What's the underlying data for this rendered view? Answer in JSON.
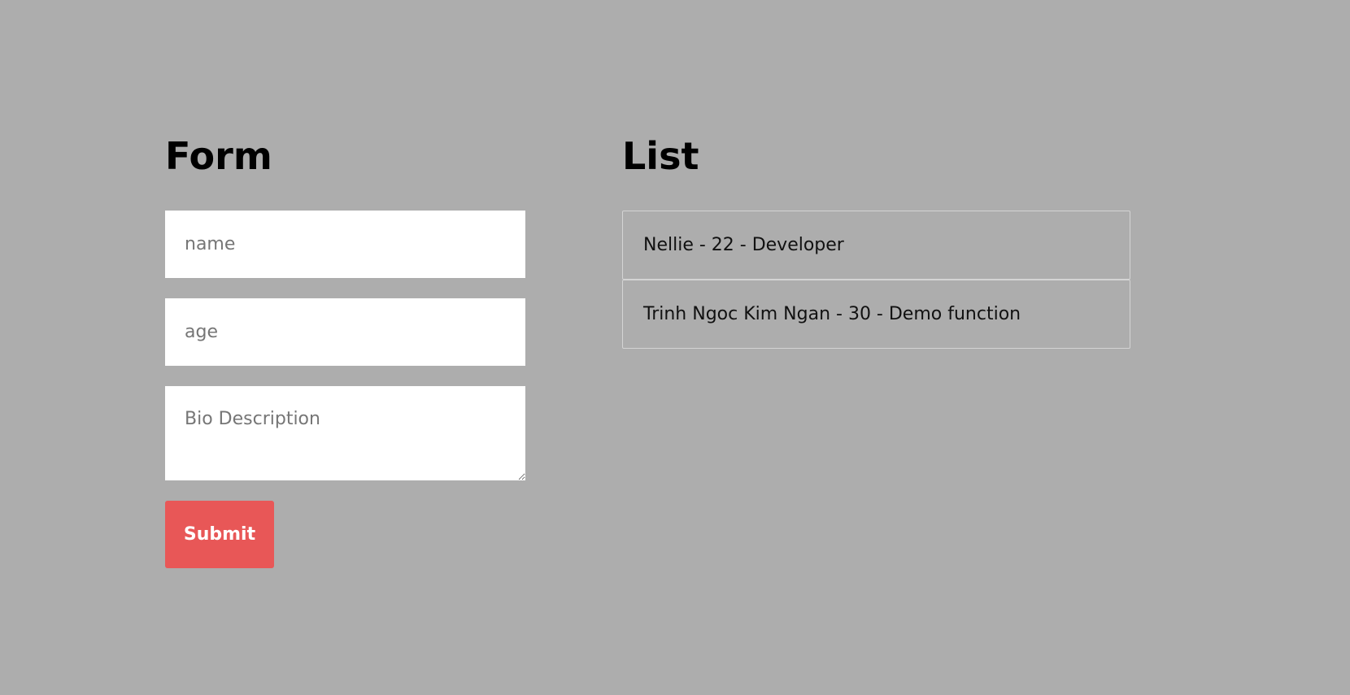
{
  "form": {
    "title": "Form",
    "name_placeholder": "name",
    "age_placeholder": "age",
    "bio_placeholder": "Bio Description",
    "submit_label": "Submit"
  },
  "list": {
    "title": "List",
    "items": [
      {
        "text": "Nellie - 22 - Developer"
      },
      {
        "text": "Trinh Ngoc Kim Ngan - 30 - Demo function"
      }
    ]
  },
  "colors": {
    "background": "#adadad",
    "submit": "#e85757"
  }
}
